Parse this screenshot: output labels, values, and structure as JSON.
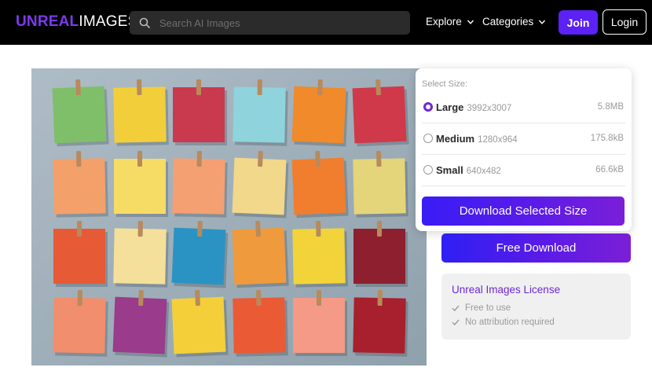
{
  "header": {
    "logo_part1": "UNREAL",
    "logo_part2": "IMAGES",
    "search_placeholder": "Search AI Images",
    "search_icon": "search-icon",
    "nav": [
      {
        "label": "Explore",
        "icon": "chevron-down-icon"
      },
      {
        "label": "Categories",
        "icon": "chevron-down-icon"
      }
    ],
    "join_label": "Join",
    "login_label": "Login"
  },
  "image": {
    "subject": "sticky notes pinned with clothespins"
  },
  "size_panel": {
    "title": "Select Size:",
    "options": [
      {
        "name": "Large",
        "dimensions": "3992x3007",
        "file_size": "5.8MB",
        "selected": true
      },
      {
        "name": "Medium",
        "dimensions": "1280x964",
        "file_size": "175.8kB",
        "selected": false
      },
      {
        "name": "Small",
        "dimensions": "640x482",
        "file_size": "66.6kB",
        "selected": false
      }
    ],
    "download_selected_label": "Download Selected Size"
  },
  "free_download_label": "Free Download",
  "license": {
    "title": "Unreal Images License",
    "items": [
      "Free to use",
      "No attribution required"
    ],
    "item_icon": "check-icon"
  },
  "colors": {
    "accent": "#6d28d9",
    "join_button": "#5b21f5",
    "header_bg": "#000000"
  }
}
